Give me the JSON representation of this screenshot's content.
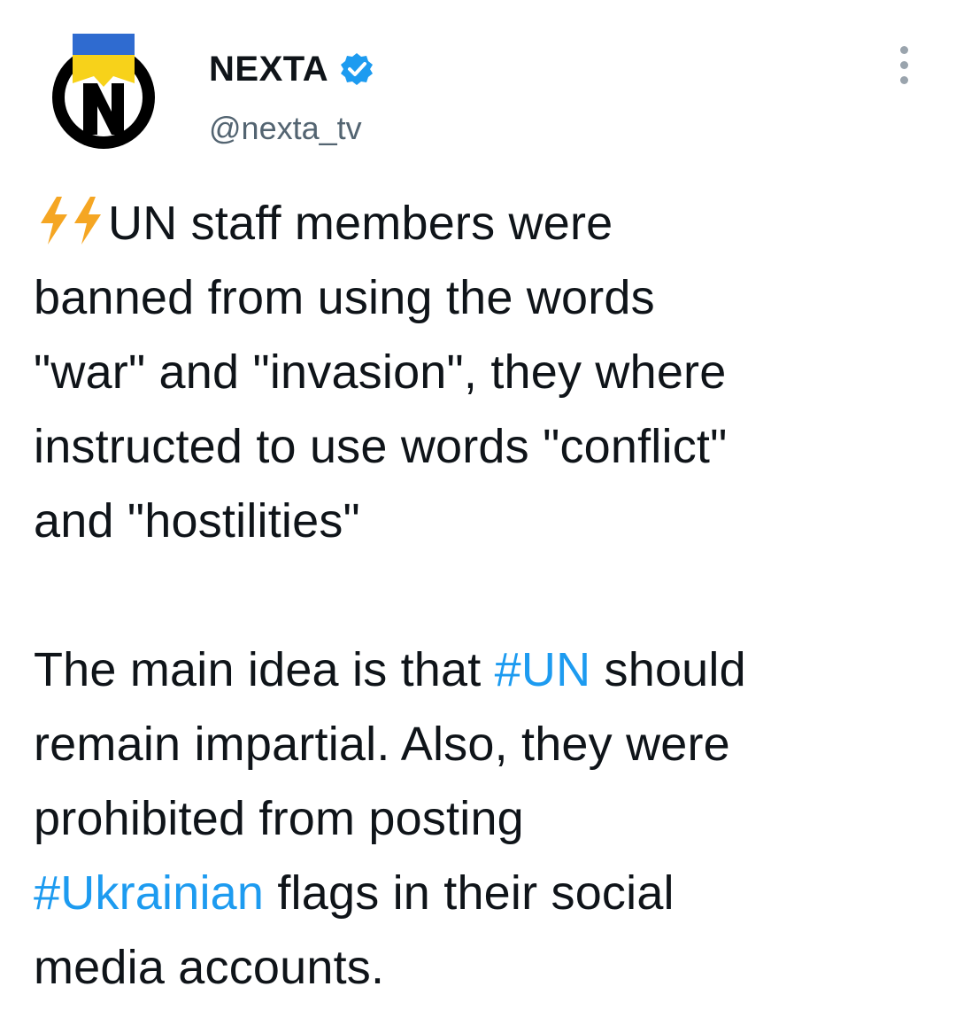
{
  "author": {
    "display_name": "NEXTA",
    "handle": "@nexta_tv",
    "avatar_letter": "N",
    "verified": true
  },
  "menu": {
    "more_icon": "more-vertical-icon"
  },
  "tweet": {
    "emoji": "lightning-bolt-icon",
    "line1": "UN staff members were",
    "line2": "banned from using the words",
    "line3": "\"war\" and \"invasion\", they where",
    "line4": "instructed to use words \"conflict\"",
    "line5": "and \"hostilities\"",
    "p2_line1_pre": "The main idea is that ",
    "p2_hashtag_un": "#UN",
    "p2_line1_post": " should",
    "p2_line2": "remain impartial. Also, they were",
    "p2_line3": "prohibited from posting",
    "p2_hashtag_ukrainian": "#Ukrainian",
    "p2_line4_post": " flags in their social",
    "p2_line5": "media accounts."
  },
  "colors": {
    "hashtag": "#1d9bf0",
    "verified": "#1d9bf0",
    "handle": "#536471",
    "flag_blue": "#2f6bd0",
    "flag_yellow": "#f7d21a",
    "bolt": "#f5a623"
  }
}
